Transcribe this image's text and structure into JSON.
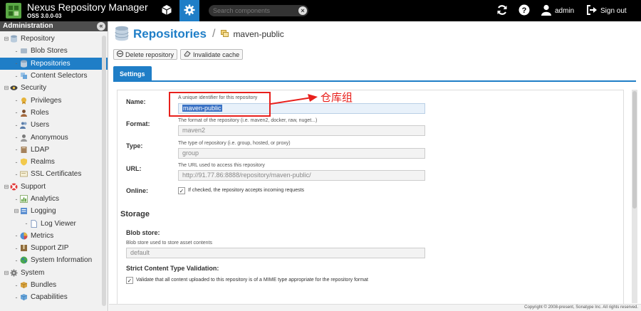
{
  "header": {
    "app_title": "Nexus Repository Manager",
    "version": "OSS 3.0.0-03",
    "search_placeholder": "Search components",
    "search_clear": "×",
    "username": "admin",
    "signout_label": "Sign out",
    "accent": "#1f7ec7"
  },
  "sidebar": {
    "title": "Administration",
    "collapse": "«",
    "items": [
      {
        "label": "Repository",
        "level": 0,
        "expanded": true,
        "icon": "database-icon",
        "selected": false
      },
      {
        "label": "Blob Stores",
        "level": 1,
        "icon": "blob-icon",
        "selected": false
      },
      {
        "label": "Repositories",
        "level": 1,
        "icon": "database-icon",
        "selected": true
      },
      {
        "label": "Content Selectors",
        "level": 1,
        "icon": "layers-icon",
        "selected": false
      },
      {
        "label": "Security",
        "level": 0,
        "expanded": true,
        "icon": "eye-icon",
        "selected": false
      },
      {
        "label": "Privileges",
        "level": 1,
        "icon": "badge-icon",
        "selected": false
      },
      {
        "label": "Roles",
        "level": 1,
        "icon": "role-icon",
        "selected": false
      },
      {
        "label": "Users",
        "level": 1,
        "icon": "users-icon",
        "selected": false
      },
      {
        "label": "Anonymous",
        "level": 1,
        "icon": "anonymous-icon",
        "selected": false
      },
      {
        "label": "LDAP",
        "level": 1,
        "icon": "book-icon",
        "selected": false
      },
      {
        "label": "Realms",
        "level": 1,
        "icon": "shield-icon",
        "selected": false
      },
      {
        "label": "SSL Certificates",
        "level": 1,
        "icon": "certificate-icon",
        "selected": false
      },
      {
        "label": "Support",
        "level": 0,
        "expanded": true,
        "icon": "lifebuoy-icon",
        "selected": false
      },
      {
        "label": "Analytics",
        "level": 1,
        "icon": "chart-icon",
        "selected": false
      },
      {
        "label": "Logging",
        "level": 1,
        "expanded": true,
        "icon": "log-icon",
        "selected": false
      },
      {
        "label": "Log Viewer",
        "level": 2,
        "icon": "document-icon",
        "selected": false
      },
      {
        "label": "Metrics",
        "level": 1,
        "icon": "pie-icon",
        "selected": false
      },
      {
        "label": "Support ZIP",
        "level": 1,
        "icon": "zip-icon",
        "selected": false
      },
      {
        "label": "System Information",
        "level": 1,
        "icon": "globe-icon",
        "selected": false
      },
      {
        "label": "System",
        "level": 0,
        "expanded": true,
        "icon": "gear-icon",
        "selected": false
      },
      {
        "label": "Bundles",
        "level": 1,
        "icon": "bundle-icon",
        "selected": false
      },
      {
        "label": "Capabilities",
        "level": 1,
        "icon": "capability-icon",
        "selected": false
      }
    ]
  },
  "main": {
    "title": "Repositories",
    "breadcrumb_sep": "/",
    "breadcrumb_current": "maven-public",
    "toolbar": {
      "delete_label": "Delete repository",
      "invalidate_label": "Invalidate cache"
    },
    "tab_settings": "Settings",
    "form": {
      "name_label": "Name:",
      "name_help": "A unique identifier for this repository",
      "name_value": "maven-public",
      "format_label": "Format:",
      "format_help": "The format of the repository (i.e. maven2, docker, raw, nuget...)",
      "format_value": "maven2",
      "type_label": "Type:",
      "type_help": "The type of repository (i.e. group, hosted, or proxy)",
      "type_value": "group",
      "url_label": "URL:",
      "url_help": "The URL used to access this repository",
      "url_value": "http://91.77.86:8888/repository/maven-public/",
      "online_label": "Online:",
      "online_help": "If checked, the repository accepts incoming requests",
      "online_checked": true,
      "storage_title": "Storage",
      "blob_store_label": "Blob store:",
      "blob_store_help": "Blob store used to store asset contents",
      "blob_store_value": "default",
      "strict_label": "Strict Content Type Validation:",
      "strict_help": "Validate that all content uploaded to this repository is of a MIME type appropriate for the repository format",
      "strict_checked": true
    }
  },
  "annotation": {
    "text": "仓库组",
    "color": "#e8201c"
  },
  "footer": {
    "copyright": "Copyright © 2008-present, Sonatype Inc. All rights reserved."
  }
}
